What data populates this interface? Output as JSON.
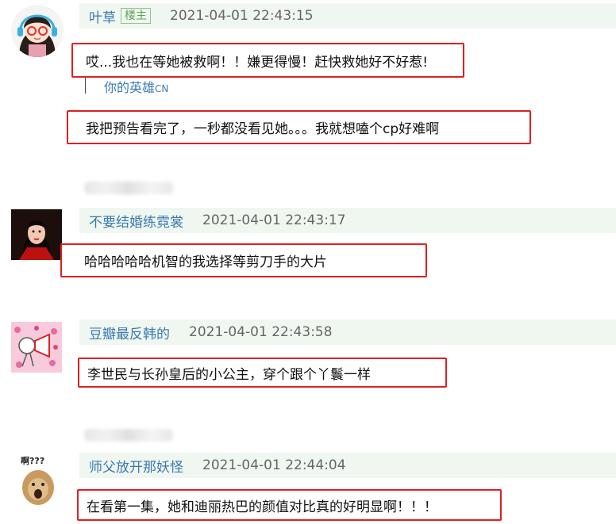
{
  "comments": [
    {
      "username": "叶草",
      "badge": "楼主",
      "timestamp": "2021-04-01 22:43:15",
      "quote_text": "哎...我也在等她被救啊！！嫌更得慢！赶快救她好不好惹!",
      "quote_author": "你的英雄",
      "quote_author_suffix": "CN",
      "reply_text": "我把预告看完了，一秒都没看见她。。。我就想嗑个cp好难啊"
    },
    {
      "username": "不要结婚练霓裳",
      "timestamp": "2021-04-01 22:43:17",
      "text": "哈哈哈哈哈机智的我选择等剪刀手的大片"
    },
    {
      "username": "豆瓣最反韩的",
      "timestamp": "2021-04-01 22:43:58",
      "text": "李世民与长孙皇后的小公主，穿个跟个丫鬟一样"
    },
    {
      "username": "师父放开那妖怪",
      "timestamp": "2021-04-01 22:44:04",
      "avatar_caption": "啊???",
      "text": "在看第一集，她和迪丽热巴的颜值对比真的好明显啊！！！"
    }
  ]
}
